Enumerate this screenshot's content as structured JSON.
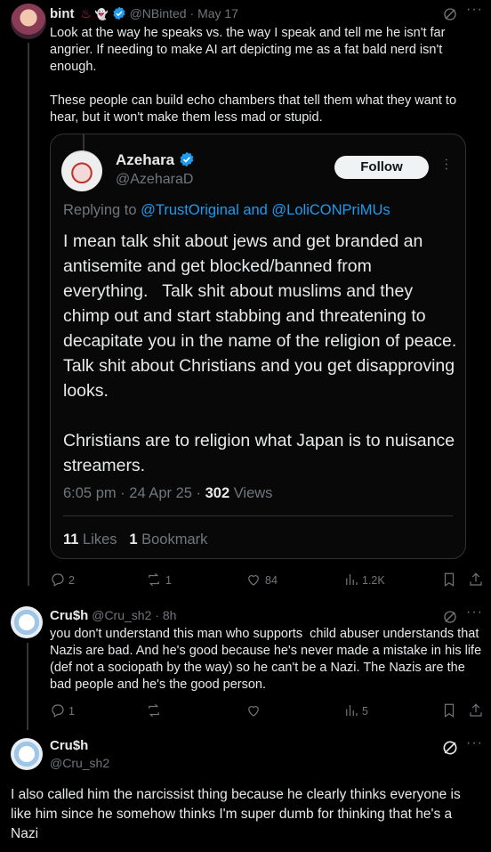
{
  "tweet1": {
    "name": "bint",
    "emoji_badges": [
      "hot-springs-icon",
      "ghost-icon"
    ],
    "handle": "@NBinted",
    "date": "May 17",
    "text": "Look at the way he speaks vs. the way I speak and tell me he isn't far angrier. If needing to make AI art depicting me as a fat bald nerd isn't enough.\n\nThese people can build echo chambers that tell them what they want to hear, but it won't make them less mad or stupid.",
    "actions": {
      "replies": "2",
      "reposts": "1",
      "likes": "84",
      "views": "1.2K"
    }
  },
  "quoted": {
    "name": "Azehara",
    "handle": "@AzeharaD",
    "follow_label": "Follow",
    "replying_prefix": "Replying to",
    "replying_to": "@TrustOriginal and @LoliCONPriMUs",
    "text": "I mean talk shit about jews and get branded an antisemite and get blocked/banned from everything.   Talk shit about muslims and they chimp out and start stabbing and threatening to decapitate you in the name of the religion of peace.  Talk shit about Christians and you get disapproving looks.\n\nChristians are to religion what Japan is to nuisance streamers.",
    "time": "6:05 pm · 24 Apr 25 · ",
    "views_count": "302",
    "views_label": " Views",
    "likes_count": "11",
    "likes_label": " Likes",
    "bookmarks_count": "1",
    "bookmarks_label": " Bookmark"
  },
  "tweet2": {
    "name": "Cru$h",
    "handle": "@Cru_sh2",
    "age": "8h",
    "text": "you don't understand this man who supports  child abuser understands that Nazis are bad. And he's good because he's never made a mistake in his life (def not a sociopath by the way) so he can't be a Nazi. The Nazis are the bad people and he's the good person.",
    "actions": {
      "replies": "1",
      "reposts": "",
      "likes": "",
      "views": "5"
    }
  },
  "tweet3": {
    "name": "Cru$h",
    "handle": "@Cru_sh2",
    "text": "I also called him the narcissist thing because he clearly thinks everyone is like him since he somehow thinks I'm super dumb for thinking that he's a Nazi"
  },
  "colors": {
    "accent": "#1d9bf0",
    "muted": "#71767b",
    "background": "#000000",
    "text": "#e7e9ea"
  }
}
